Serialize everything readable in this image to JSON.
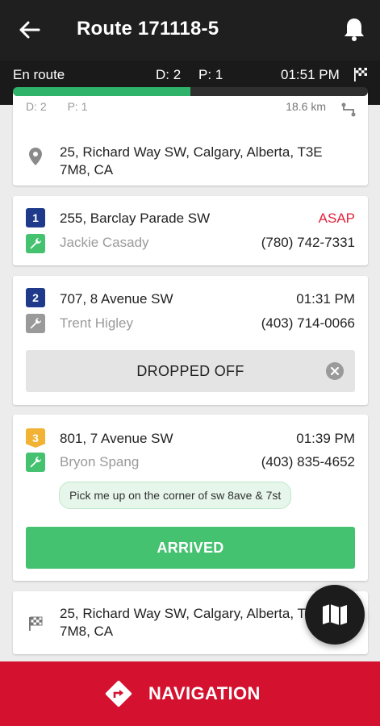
{
  "header": {
    "title": "Route 171118-5"
  },
  "status": {
    "state": "En route",
    "deliveries": "D: 2",
    "pickups": "P: 1",
    "time": "01:51 PM",
    "progress": 0.5
  },
  "start_card": {
    "deliveries": "D: 2",
    "pickups": "P: 1",
    "distance": "18.6 km",
    "address": "25, Richard Way SW, Calgary, Alberta, T3E 7M8, CA"
  },
  "stops": [
    {
      "number": "1",
      "number_color": "#1f3a8a",
      "tool_color": "#45c270",
      "street": "255, Barclay Parade SW",
      "time": "ASAP",
      "time_color": "#e0233c",
      "person": "Jackie Casady",
      "phone": "(780) 742-7331"
    },
    {
      "number": "2",
      "number_color": "#1f3a8a",
      "tool_color": "#9a9a9a",
      "street": "707, 8 Avenue SW",
      "time": "01:31 PM",
      "person": "Trent Higley",
      "phone": "(403) 714-0066",
      "action": "DROPPED OFF"
    },
    {
      "number": "3",
      "number_color": "#f2b233",
      "tool_color": "#45c270",
      "street": "801, 7 Avenue SW",
      "time": "01:39 PM",
      "person": "Bryon Spang",
      "phone": "(403) 835-4652",
      "note": "Pick me up on the corner of sw 8ave & 7st",
      "action": "ARRIVED"
    }
  ],
  "end_card": {
    "address": "25, Richard Way SW, Calgary, Alberta, T3E 7M8, CA"
  },
  "bottom": {
    "navigation_label": "NAVIGATION"
  },
  "colors": {
    "accent_green": "#45c270",
    "navigation_red": "#d4112e",
    "appbar": "#1f1f1f"
  }
}
